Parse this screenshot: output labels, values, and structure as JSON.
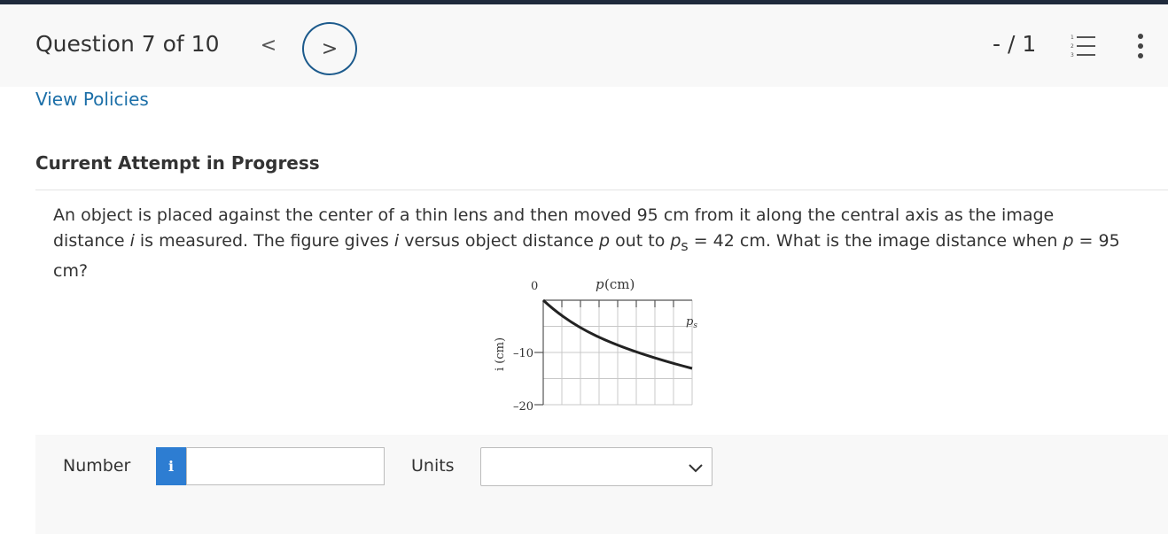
{
  "header": {
    "question_title": "Question 7 of 10",
    "prev_glyph": "<",
    "next_glyph": ">",
    "score": "- / 1"
  },
  "links": {
    "view_policies": "View Policies"
  },
  "attempt_status": "Current Attempt in Progress",
  "question": {
    "part1": "An object is placed against the center of a thin lens and then moved 95 cm from it along the central axis as the image distance ",
    "var_i": "i",
    "part2": " is measured. The figure gives ",
    "var_i2": "i",
    "part3": " versus object distance ",
    "var_p": "p",
    "part4": " out to ",
    "var_ps": "p",
    "ps_sub": "s",
    "part5": " = 42 cm. What is the image distance when ",
    "var_p2": "p",
    "part6": " = 95 cm?"
  },
  "figure": {
    "x_origin_label": "0",
    "x_axis_label": "p (cm)",
    "ps_label": "p",
    "ps_sub": "s",
    "y_axis_label": "i (cm)",
    "y_tick_minus10": "–10",
    "y_tick_minus20": "–20"
  },
  "answer": {
    "number_label": "Number",
    "info_glyph": "i",
    "number_value": "",
    "units_label": "Units",
    "units_value": ""
  },
  "icons": {
    "prev": "chevron-left-icon",
    "next": "chevron-right-icon",
    "list": "numbered-list-icon",
    "more": "vertical-ellipsis-icon",
    "dropdown": "chevron-down-icon"
  },
  "colors": {
    "accent_blue": "#2d7dd2",
    "link_blue": "#1c6fa8",
    "next_ring": "#1c5a8c",
    "top_bar": "#1f2a3c"
  }
}
